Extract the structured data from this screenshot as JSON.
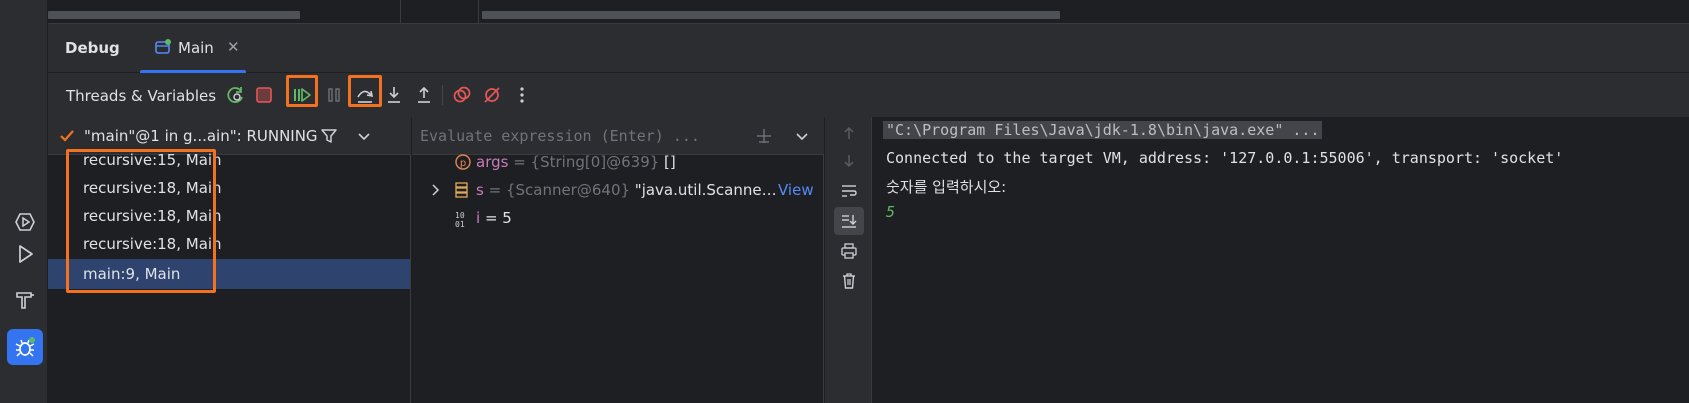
{
  "top": {
    "title": "Debug",
    "tab": {
      "label": "Main"
    }
  },
  "toolbar": {
    "threads_label": "Threads & Variables"
  },
  "thread": {
    "label": "\"main\"@1 in g...ain\": RUNNING"
  },
  "frames": [
    {
      "label": "recursive:15, Main",
      "selected": false
    },
    {
      "label": "recursive:18, Main",
      "selected": false
    },
    {
      "label": "recursive:18, Main",
      "selected": false
    },
    {
      "label": "recursive:18, Main",
      "selected": false
    },
    {
      "label": "main:9, Main",
      "selected": true
    }
  ],
  "evaluate": {
    "placeholder": "Evaluate expression (Enter) ..."
  },
  "variables": [
    {
      "name": "args",
      "eq": " = ",
      "type": "{String[0]@639}",
      "value": " []",
      "kind": "param"
    },
    {
      "name": "s",
      "eq": " = ",
      "type": "{Scanner@640}",
      "value": " \"java.util.Scanne…",
      "link": "View",
      "kind": "object",
      "expandable": true
    },
    {
      "name": "i",
      "eq": " = ",
      "value": "5",
      "kind": "primitive"
    }
  ],
  "console": {
    "command": "\"C:\\Program Files\\Java\\jdk-1.8\\bin\\java.exe\" ...",
    "connected": "Connected to the target VM, address: '127.0.0.1:55006', transport: 'socket'",
    "prompt": "숫자를 입력하시오:",
    "input": "5"
  },
  "colors": {
    "accent": "#3574f0",
    "highlight": "#f37221",
    "selection": "#2e436e",
    "resume_green": "#5fb865",
    "stop_red": "#e55757"
  }
}
